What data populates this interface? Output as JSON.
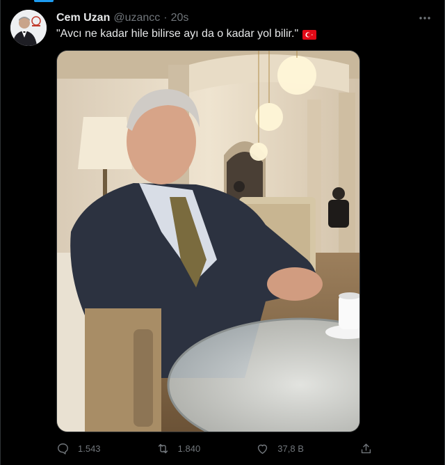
{
  "tweet": {
    "author_name": "Cem Uzan",
    "author_handle": "@uzancc",
    "separator": "·",
    "timestamp": "20s",
    "text": "\"Avcı ne kadar hile bilirse ayı da o kadar yol bilir.\"",
    "flag_icon": "turkish-flag-icon"
  },
  "actions": {
    "reply_count": "1.543",
    "retweet_count": "1.840",
    "like_count": "37,8 B"
  },
  "colors": {
    "background": "#000000",
    "text": "#e7e9ea",
    "muted": "#71767b",
    "accent": "#1d9bf0",
    "flag_red": "#e30a17"
  }
}
